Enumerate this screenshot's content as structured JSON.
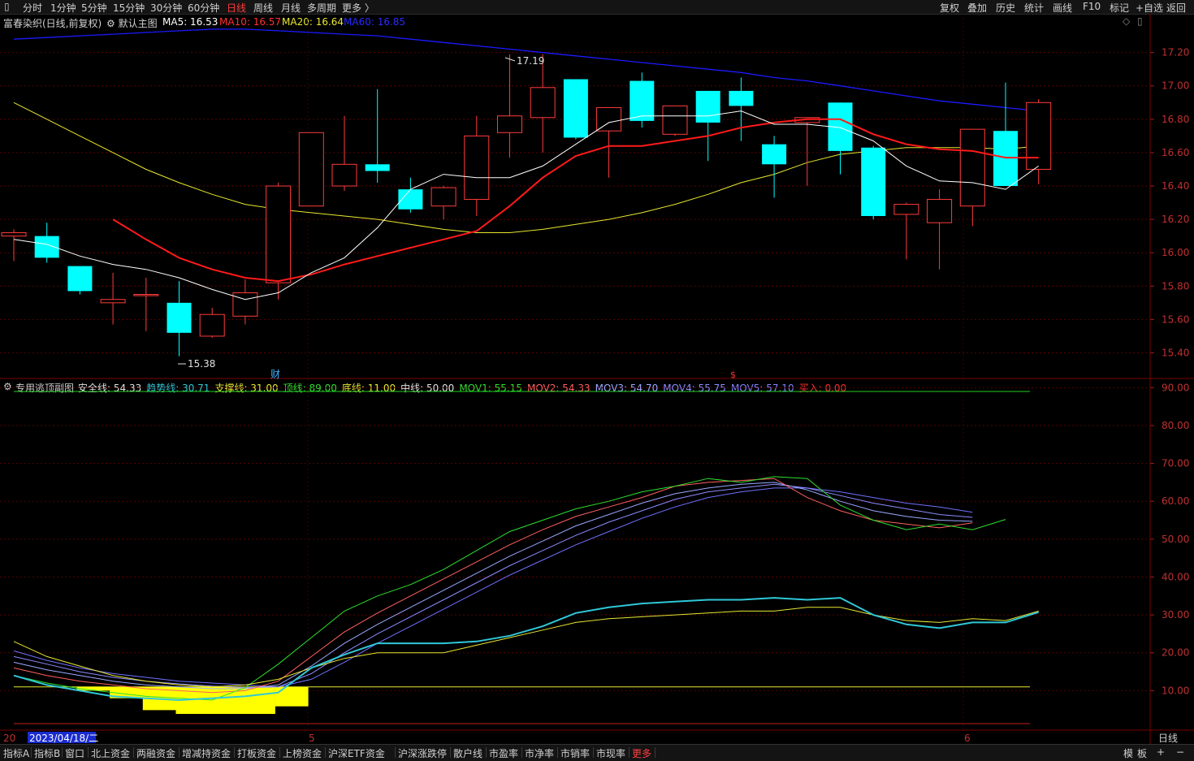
{
  "toolbar": {
    "periods": [
      "分时",
      "1分钟",
      "5分钟",
      "15分钟",
      "30分钟",
      "60分钟",
      "日线",
      "周线",
      "月线",
      "多周期",
      "更多 〉"
    ],
    "active_period": "日线",
    "right": [
      "复权",
      "叠加",
      "历史",
      "统计",
      "画线",
      "F10",
      "标记",
      "+自选",
      "返回"
    ]
  },
  "main_header": {
    "stock": "富春染织(日线,前复权)",
    "template": "默认主图",
    "ma5": "MA5: 16.53",
    "ma10": "MA10: 16.57",
    "ma20": "MA20: 16.64",
    "ma60": "MA60: 16.85"
  },
  "sub_header": {
    "name": "专用逃顶副图",
    "items": [
      {
        "text": "安全线: 54.33",
        "color": "#e0e0e0"
      },
      {
        "text": "趋势线: 30.71",
        "color": "#2fc8d8"
      },
      {
        "text": "支撑线: 31.00",
        "color": "#e8e830"
      },
      {
        "text": "顶线: 89.00",
        "color": "#2ee02e"
      },
      {
        "text": "底线: 11.00",
        "color": "#e8e830"
      },
      {
        "text": "中线: 50.00",
        "color": "#e0e0e0"
      },
      {
        "text": "MOV1: 55.15",
        "color": "#2ee02e"
      },
      {
        "text": "MOV2: 54.33",
        "color": "#ff6060"
      },
      {
        "text": "MOV3: 54.70",
        "color": "#9aa8ff"
      },
      {
        "text": "MOV4: 55.75",
        "color": "#8c8cff"
      },
      {
        "text": "MOV5: 57.10",
        "color": "#8080ff"
      },
      {
        "text": "买入: 0.00",
        "color": "#ff3030"
      }
    ]
  },
  "annotations": {
    "high": "17.19",
    "low": "15.38",
    "marker_cai": "财",
    "marker_s": "$",
    "date_cursor": "2023/04/18/二",
    "date_prefix": "20",
    "month_5": "5",
    "month_6": "6",
    "period_label": "日线"
  },
  "colors": {
    "up": "#ff3b3b",
    "down": "#00ffff",
    "ma5": "#ffffff",
    "ma10": "#ff1a1a",
    "ma20": "#e8e830",
    "ma60": "#1a1aff",
    "grid": "#5a0000",
    "axis_text": "#c03030"
  },
  "bottom_tabs": [
    "指标A",
    "指标B",
    "窗口",
    "北上资金",
    "两融资金",
    "增减持资金",
    "打板资金",
    "上榜资金",
    "沪深ETF资金",
    "沪深涨跌停",
    "散户线",
    "市盈率",
    "市净率",
    "市销率",
    "市现率",
    "更多"
  ],
  "bottom_right": [
    "模",
    "板",
    "+",
    "−"
  ],
  "chart_data": {
    "type": "candlestick",
    "main": {
      "ylim": [
        15.3,
        17.32
      ],
      "yticks": [
        15.4,
        15.6,
        15.8,
        16.0,
        16.2,
        16.4,
        16.6,
        16.8,
        17.0,
        17.2
      ],
      "candles": [
        {
          "o": 16.1,
          "h": 16.14,
          "l": 15.95,
          "c": 16.12
        },
        {
          "o": 16.1,
          "h": 16.18,
          "l": 15.94,
          "c": 15.97
        },
        {
          "o": 15.92,
          "h": 15.92,
          "l": 15.75,
          "c": 15.77
        },
        {
          "o": 15.7,
          "h": 15.88,
          "l": 15.57,
          "c": 15.72
        },
        {
          "o": 15.75,
          "h": 15.85,
          "l": 15.53,
          "c": 15.75
        },
        {
          "o": 15.7,
          "h": 15.83,
          "l": 15.38,
          "c": 15.52
        },
        {
          "o": 15.5,
          "h": 15.67,
          "l": 15.49,
          "c": 15.63
        },
        {
          "o": 15.62,
          "h": 15.84,
          "l": 15.57,
          "c": 15.76
        },
        {
          "o": 15.82,
          "h": 16.42,
          "l": 15.72,
          "c": 16.4
        },
        {
          "o": 16.28,
          "h": 16.72,
          "l": 16.28,
          "c": 16.72
        },
        {
          "o": 16.4,
          "h": 16.82,
          "l": 16.37,
          "c": 16.53
        },
        {
          "o": 16.53,
          "h": 16.98,
          "l": 16.42,
          "c": 16.49
        },
        {
          "o": 16.38,
          "h": 16.45,
          "l": 16.24,
          "c": 16.26
        },
        {
          "o": 16.28,
          "h": 16.4,
          "l": 16.2,
          "c": 16.39
        },
        {
          "o": 16.32,
          "h": 16.82,
          "l": 16.22,
          "c": 16.7
        },
        {
          "o": 16.72,
          "h": 17.19,
          "l": 16.57,
          "c": 16.82
        },
        {
          "o": 16.81,
          "h": 17.19,
          "l": 16.6,
          "c": 16.99
        },
        {
          "o": 17.04,
          "h": 17.04,
          "l": 16.68,
          "c": 16.69
        },
        {
          "o": 16.73,
          "h": 16.87,
          "l": 16.45,
          "c": 16.87
        },
        {
          "o": 17.03,
          "h": 17.08,
          "l": 16.75,
          "c": 16.79
        },
        {
          "o": 16.71,
          "h": 16.88,
          "l": 16.7,
          "c": 16.88
        },
        {
          "o": 16.97,
          "h": 16.97,
          "l": 16.55,
          "c": 16.78
        },
        {
          "o": 16.97,
          "h": 17.05,
          "l": 16.67,
          "c": 16.88
        },
        {
          "o": 16.65,
          "h": 16.7,
          "l": 16.33,
          "c": 16.53
        },
        {
          "o": 16.78,
          "h": 16.8,
          "l": 16.4,
          "c": 16.81
        },
        {
          "o": 16.9,
          "h": 16.9,
          "l": 16.47,
          "c": 16.61
        },
        {
          "o": 16.63,
          "h": 16.64,
          "l": 16.2,
          "c": 16.22
        },
        {
          "o": 16.23,
          "h": 16.3,
          "l": 15.96,
          "c": 16.29
        },
        {
          "o": 16.18,
          "h": 16.38,
          "l": 15.9,
          "c": 16.32
        },
        {
          "o": 16.28,
          "h": 16.74,
          "l": 16.16,
          "c": 16.74
        },
        {
          "o": 16.73,
          "h": 17.02,
          "l": 16.4,
          "c": 16.4
        },
        {
          "o": 16.5,
          "h": 16.92,
          "l": 16.41,
          "c": 16.9
        }
      ],
      "ma5": [
        16.08,
        16.05,
        15.98,
        15.93,
        15.9,
        15.85,
        15.78,
        15.72,
        15.76,
        15.88,
        15.97,
        16.15,
        16.38,
        16.47,
        16.45,
        16.45,
        16.52,
        16.65,
        16.78,
        16.82,
        16.82,
        16.82,
        16.85,
        16.77,
        16.77,
        16.75,
        16.67,
        16.52,
        16.43,
        16.42,
        16.38,
        16.52
      ],
      "ma10": [
        null,
        null,
        null,
        16.2,
        16.08,
        15.97,
        15.9,
        15.85,
        15.83,
        15.87,
        15.93,
        15.98,
        16.03,
        16.08,
        16.13,
        16.28,
        16.45,
        16.58,
        16.64,
        16.64,
        16.67,
        16.7,
        16.75,
        16.78,
        16.8,
        16.8,
        16.71,
        16.65,
        16.62,
        16.61,
        16.57,
        16.57
      ],
      "ma20": [
        16.9,
        16.8,
        16.7,
        16.6,
        16.5,
        16.42,
        16.35,
        16.29,
        16.26,
        16.24,
        16.22,
        16.2,
        16.17,
        16.14,
        16.12,
        16.12,
        16.14,
        16.17,
        16.2,
        16.24,
        16.29,
        16.35,
        16.42,
        16.47,
        16.54,
        16.59,
        16.61,
        16.63,
        16.63,
        16.63,
        16.62,
        16.64
      ],
      "ma60": [
        17.28,
        17.29,
        17.3,
        17.31,
        17.32,
        17.33,
        17.34,
        17.34,
        17.33,
        17.32,
        17.31,
        17.3,
        17.28,
        17.26,
        17.24,
        17.22,
        17.2,
        17.18,
        17.16,
        17.14,
        17.12,
        17.1,
        17.08,
        17.05,
        17.03,
        17.0,
        16.97,
        16.94,
        16.91,
        16.89,
        16.87,
        16.85
      ]
    },
    "sub": {
      "ylim": [
        0,
        92
      ],
      "yticks": [
        10.0,
        20.0,
        30.0,
        40.0,
        50.0,
        60.0,
        70.0,
        80.0,
        90.0
      ],
      "top_line": 89,
      "bottom_line": 11,
      "mid_line": 50,
      "mov1": [
        14.0,
        12.0,
        10.5,
        9.5,
        8.5,
        8.0,
        7.5,
        10.8,
        17.0,
        24.0,
        31.0,
        35.0,
        38.0,
        42.0,
        47.0,
        52.0,
        55.0,
        58.0,
        60.0,
        62.5,
        64.0,
        66.0,
        65.0,
        66.5,
        66.0,
        59.0,
        55.0,
        52.5,
        54.0,
        52.5,
        55.2
      ],
      "mov2": [
        16.0,
        14.0,
        12.5,
        11.5,
        10.5,
        10.0,
        9.5,
        10.0,
        12.5,
        19.0,
        25.5,
        30.5,
        35.0,
        39.5,
        44.0,
        48.5,
        52.5,
        56.0,
        58.5,
        61.0,
        64.0,
        65.0,
        65.5,
        66.0,
        61.0,
        57.5,
        55.0,
        54.0,
        53.0,
        54.3
      ],
      "mov3": [
        17.5,
        15.5,
        14.0,
        12.5,
        11.5,
        11.0,
        10.5,
        10.5,
        11.5,
        16.5,
        22.5,
        27.5,
        32.0,
        36.5,
        41.0,
        45.5,
        49.5,
        53.5,
        56.5,
        59.5,
        62.0,
        63.5,
        64.5,
        65.0,
        63.0,
        60.0,
        57.5,
        56.0,
        55.0,
        54.7
      ],
      "mov4": [
        19.0,
        17.0,
        15.0,
        13.5,
        12.5,
        11.8,
        11.2,
        10.8,
        11.0,
        14.5,
        20.0,
        25.0,
        29.5,
        34.0,
        38.5,
        43.0,
        47.0,
        51.0,
        54.5,
        57.5,
        60.5,
        62.5,
        63.5,
        64.5,
        63.5,
        61.5,
        59.5,
        58.0,
        56.5,
        55.75
      ],
      "mov5": [
        20.5,
        18.0,
        16.0,
        14.5,
        13.5,
        12.5,
        12.0,
        11.5,
        11.0,
        13.0,
        17.5,
        22.5,
        27.0,
        31.5,
        36.0,
        40.5,
        44.5,
        48.5,
        52.0,
        55.5,
        58.5,
        61.0,
        62.5,
        63.5,
        63.5,
        62.5,
        61.0,
        59.5,
        58.5,
        57.1
      ],
      "trend": [
        14.0,
        11.5,
        10.0,
        8.5,
        8.0,
        7.5,
        8.0,
        8.5,
        9.5,
        16.0,
        19.5,
        22.5,
        22.5,
        22.5,
        23.0,
        24.5,
        27.0,
        30.5,
        32.0,
        33.0,
        33.5,
        34.0,
        34.0,
        34.5,
        34.0,
        34.5,
        30.0,
        27.5,
        26.5,
        28.0,
        28.0,
        30.7
      ],
      "support": [
        23.0,
        19.0,
        16.5,
        14.0,
        12.5,
        11.5,
        11.0,
        11.5,
        13.0,
        16.0,
        18.5,
        20.0,
        20.0,
        20.0,
        22.0,
        24.0,
        26.0,
        28.0,
        29.0,
        29.5,
        30.0,
        30.5,
        31.0,
        31.0,
        32.0,
        32.0,
        30.0,
        28.5,
        28.0,
        29.0,
        28.5,
        31.0
      ],
      "bars": [
        11,
        10,
        8,
        7,
        6,
        6,
        6,
        8,
        11
      ]
    }
  }
}
